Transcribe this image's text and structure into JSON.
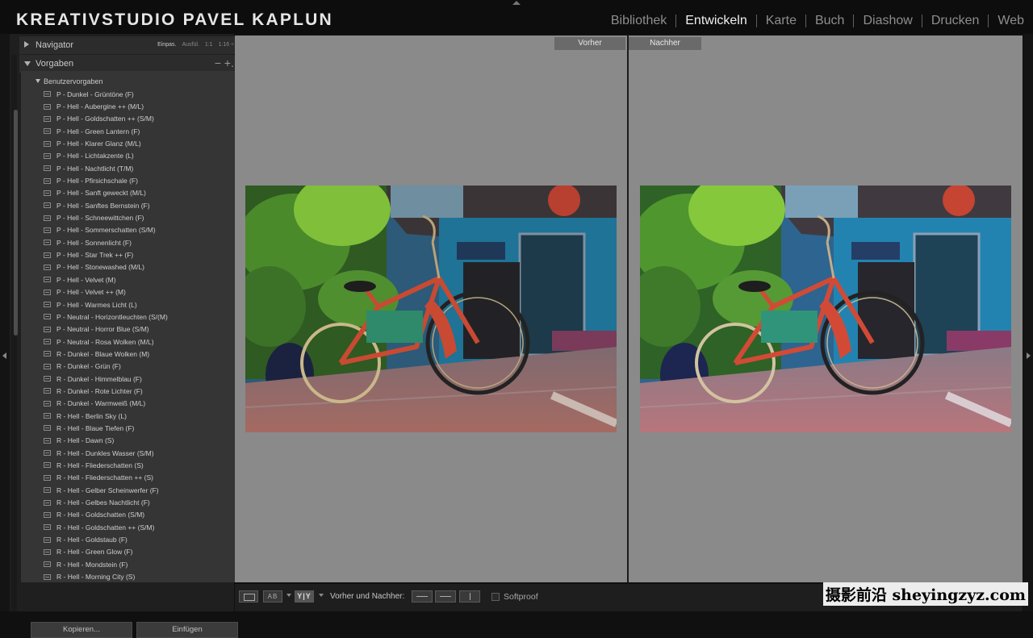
{
  "header": {
    "brand": "KREATIVSTUDIO PAVEL KAPLUN",
    "modules": [
      "Bibliothek",
      "Entwickeln",
      "Karte",
      "Buch",
      "Diashow",
      "Drucken",
      "Web"
    ],
    "active_module": "Entwickeln"
  },
  "navigator": {
    "title": "Navigator",
    "zoom_options": [
      "Einpas.",
      "Ausfül.",
      "1:1",
      "1:16 ÷"
    ]
  },
  "presets": {
    "title": "Vorgaben",
    "minus": "−",
    "plus": "+.",
    "folder": "Benutzervorgaben",
    "items": [
      "P - Dunkel - Grüntöne (F)",
      "P - Hell - Aubergine ++ (M/L)",
      "P - Hell - Goldschatten ++ (S/M)",
      "P - Hell - Green Lantern (F)",
      "P - Hell - Klarer Glanz (M/L)",
      "P - Hell - Lichtakzente (L)",
      "P - Hell - Nachtlicht (T/M)",
      "P - Hell - Pfirsichschale (F)",
      "P - Hell - Sanft geweckt (M/L)",
      "P - Hell - Sanftes Bernstein (F)",
      "P - Hell - Schneewittchen (F)",
      "P - Hell - Sommerschatten (S/M)",
      "P - Hell - Sonnenlicht (F)",
      "P - Hell - Star Trek ++ (F)",
      "P - Hell - Stonewashed (M/L)",
      "P - Hell - Velvet (M)",
      "P - Hell - Velvet ++ (M)",
      "P - Hell - Warmes Licht (L)",
      "P - Neutral - Horizontleuchten (S/(M)",
      "P - Neutral - Horror Blue (S/M)",
      "P - Neutral - Rosa Wolken (M/L)",
      "R - Dunkel - Blaue Wolken (M)",
      "R - Dunkel - Grün (F)",
      "R - Dunkel - Himmelblau (F)",
      "R - Dunkel - Rote Lichter (F)",
      "R - Dunkel - Warmweiß (M/L)",
      "R - Hell - Berlin Sky (L)",
      "R - Hell - Blaue Tiefen (F)",
      "R - Hell - Dawn (S)",
      "R - Hell - Dunkles Wasser (S/M)",
      "R - Hell - Fliederschatten (S)",
      "R - Hell - Fliederschatten ++ (S)",
      "R - Hell - Gelber Scheinwerfer (F)",
      "R - Hell - Gelbes Nachtlicht (F)",
      "R - Hell - Goldschatten (S/M)",
      "R - Hell - Goldschatten ++ (S/M)",
      "R - Hell - Goldstaub (F)",
      "R - Hell - Green Glow (F)",
      "R - Hell - Mondstein (F)",
      "R - Hell - Morning City (S)"
    ]
  },
  "buttons": {
    "copy": "Kopieren...",
    "paste": "Einfügen"
  },
  "compare": {
    "before_label": "Vorher",
    "after_label": "Nachher"
  },
  "toolbar": {
    "ab_icon": "AB",
    "yy_icon": "Y|Y",
    "before_after_label": "Vorher und Nachher:",
    "softproof_label": "Softproof",
    "softproof_checked": false
  },
  "watermark": "摄影前沿 sheyingzyz.com",
  "colors": {
    "background": "#101010",
    "panel": "#353535",
    "view": "#8a8a8a",
    "bike_red": "#c84a32",
    "wall_teal": "#1f7f9c"
  }
}
